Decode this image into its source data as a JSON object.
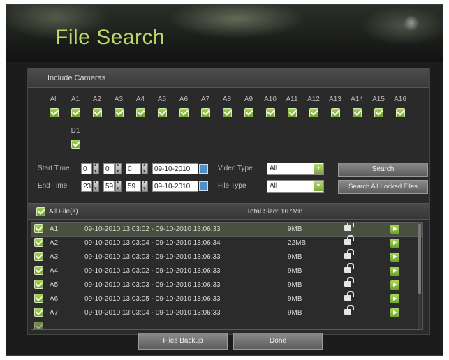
{
  "title": "File Search",
  "cameras": {
    "section_label": "Include Cameras",
    "items": [
      {
        "label": "All",
        "checked": true
      },
      {
        "label": "A1",
        "checked": true
      },
      {
        "label": "A2",
        "checked": true
      },
      {
        "label": "A3",
        "checked": true
      },
      {
        "label": "A4",
        "checked": true
      },
      {
        "label": "A5",
        "checked": true
      },
      {
        "label": "A6",
        "checked": true
      },
      {
        "label": "A7",
        "checked": true
      },
      {
        "label": "A8",
        "checked": true
      },
      {
        "label": "A9",
        "checked": true
      },
      {
        "label": "A10",
        "checked": true
      },
      {
        "label": "A11",
        "checked": true
      },
      {
        "label": "A12",
        "checked": true
      },
      {
        "label": "A13",
        "checked": true
      },
      {
        "label": "A14",
        "checked": true
      },
      {
        "label": "A15",
        "checked": true
      },
      {
        "label": "A16",
        "checked": true
      },
      {
        "label": "D1",
        "checked": true
      }
    ]
  },
  "start_time": {
    "label": "Start Time",
    "hour": "0",
    "minute": "0",
    "second": "0",
    "date": "09-10-2010"
  },
  "end_time": {
    "label": "End Time",
    "hour": "23",
    "minute": "59",
    "second": "59",
    "date": "09-10-2010"
  },
  "video_type": {
    "label": "Video Type",
    "value": "All"
  },
  "file_type": {
    "label": "File Type",
    "value": "All"
  },
  "buttons": {
    "search": "Search",
    "search_locked": "Search All Locked Files",
    "backup": "Files Backup",
    "done": "Done"
  },
  "files": {
    "all_label": "All File(s)",
    "total_size": "Total Size: 167MB",
    "rows": [
      {
        "cam": "A1",
        "time": "09-10-2010 13:03:02 - 09-10-2010 13:06:33",
        "size": "9MB"
      },
      {
        "cam": "A2",
        "time": "09-10-2010 13:03:04 - 09-10-2010 13:06:34",
        "size": "22MB"
      },
      {
        "cam": "A3",
        "time": "09-10-2010 13:03:03 - 09-10-2010 13:06:33",
        "size": "9MB"
      },
      {
        "cam": "A4",
        "time": "09-10-2010 13:03:02 - 09-10-2010 13:06:33",
        "size": "9MB"
      },
      {
        "cam": "A5",
        "time": "09-10-2010 13:03:03 - 09-10-2010 13:06:33",
        "size": "9MB"
      },
      {
        "cam": "A6",
        "time": "09-10-2010 13:03:05 - 09-10-2010 13:06:33",
        "size": "9MB"
      },
      {
        "cam": "A7",
        "time": "09-10-2010 13:03:04 - 09-10-2010 13:06:33",
        "size": "9MB"
      }
    ]
  },
  "icons": {
    "lock": "unlock-icon",
    "play": "play-icon",
    "calendar": "calendar-icon",
    "checkbox": "checkbox-icon"
  },
  "colors": {
    "accent": "#b9d96a",
    "check": "#7fb63a",
    "background": "#1c1c1c"
  }
}
